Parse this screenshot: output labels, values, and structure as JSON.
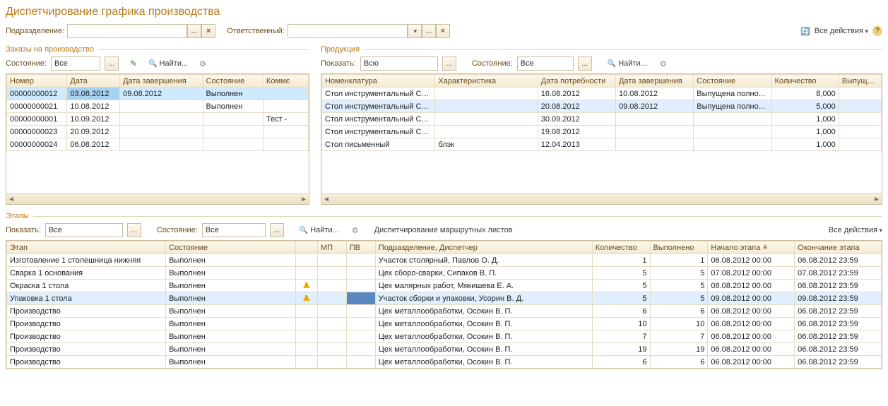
{
  "title": "Диспетчирование графика производства",
  "filters": {
    "dept_label": "Подразделение:",
    "dept_value": "",
    "resp_label": "Ответственный:",
    "resp_value": "",
    "all_actions": "Все действия"
  },
  "orders_section": {
    "legend": "Заказы на производство",
    "state_label": "Состояние:",
    "state_value": "Все",
    "find": "Найти...",
    "cols": {
      "num": "Номер",
      "date": "Дата",
      "end": "Дата завершения",
      "state": "Состояние",
      "comment": "Коммє"
    },
    "rows": [
      {
        "num": "00000000012",
        "date": "03.08.2012",
        "end": "09.08.2012",
        "state": "Выполнен",
        "comment": "",
        "sel": true
      },
      {
        "num": "00000000021",
        "date": "10.08.2012",
        "end": "",
        "state": "Выполнен",
        "comment": ""
      },
      {
        "num": "00000000001",
        "date": "10.09.2012",
        "end": "",
        "state": "",
        "comment": "Тест -"
      },
      {
        "num": "00000000023",
        "date": "20.09.2012",
        "end": "",
        "state": "",
        "comment": ""
      },
      {
        "num": "00000000024",
        "date": "06.08.2012",
        "end": "",
        "state": "",
        "comment": ""
      }
    ]
  },
  "products_section": {
    "legend": "Продукция",
    "show_label": "Показать:",
    "show_value": "Всю",
    "state_label": "Состояние:",
    "state_value": "Все",
    "find": "Найти...",
    "cols": {
      "nom": "Номенклатура",
      "char": "Характеристика",
      "need": "Дата потребности",
      "end": "Дата завершения",
      "state": "Состояние",
      "qty": "Количество",
      "out": "Выпущено"
    },
    "rows": [
      {
        "nom": "Стол инструментальный СИ...",
        "char": "",
        "need": "16.08.2012",
        "end": "10.08.2012",
        "state": "Выпущена полно...",
        "qty": "8,000",
        "out": ""
      },
      {
        "nom": "Стол инструментальный СИ...",
        "char": "",
        "need": "20.08.2012",
        "end": "09.08.2012",
        "state": "Выпущена полно...",
        "qty": "5,000",
        "out": "",
        "sel": true
      },
      {
        "nom": "Стол инструментальный СИ...",
        "char": "",
        "need": "30.09.2012",
        "end": "",
        "state": "",
        "qty": "1,000",
        "out": ""
      },
      {
        "nom": "Стол инструментальный СИ...",
        "char": "",
        "need": "19.08.2012",
        "end": "",
        "state": "",
        "qty": "1,000",
        "out": ""
      },
      {
        "nom": "Стол письменный",
        "char": "блэк",
        "need": "12.04.2013",
        "end": "",
        "state": "",
        "qty": "1,000",
        "out": ""
      }
    ]
  },
  "stages_section": {
    "legend": "Этапы",
    "show_label": "Показать:",
    "show_value": "Все",
    "state_label": "Состояние:",
    "state_value": "Все",
    "find": "Найти...",
    "dispatch_link": "Диспетчирование маршрутных листов",
    "all_actions": "Все действия",
    "cols": {
      "stage": "Этап",
      "state": "Состояние",
      "warn": "",
      "mp": "МП",
      "pv": "ПВ",
      "dept": "Подразделение, Диспетчер",
      "qty": "Количество",
      "done": "Выполнено",
      "start": "Начало этапа",
      "end": "Окончание этапа"
    },
    "rows": [
      {
        "stage": "Изготовление 1 столешница нижняя",
        "state": "Выполнен",
        "warn": false,
        "dept": "Участок столярный, Павлов О. Д.",
        "qty": "1",
        "done": "1",
        "start": "06.08.2012 00:00",
        "end": "06.08.2012 23:59"
      },
      {
        "stage": "Сварка 1 основания",
        "state": "Выполнен",
        "warn": false,
        "dept": "Цех сборо-сварки, Сипаков В. П.",
        "qty": "5",
        "done": "5",
        "start": "07.08.2012 00:00",
        "end": "07.08.2012 23:59"
      },
      {
        "stage": "Окраска 1 стола",
        "state": "Выполнен",
        "warn": true,
        "dept": "Цех малярных работ, Мякишева Е. А.",
        "qty": "5",
        "done": "5",
        "start": "08.08.2012 00:00",
        "end": "08.08.2012 23:59"
      },
      {
        "stage": "Упаковка 1 стола",
        "state": "Выполнен",
        "warn": true,
        "dept": "Участок сборки и упаковки, Усорин В. Д.",
        "qty": "5",
        "done": "5",
        "start": "09.08.2012 00:00",
        "end": "09.08.2012 23:59",
        "sel": true
      },
      {
        "stage": "Производство",
        "state": "Выполнен",
        "warn": false,
        "dept": "Цех металлообработки, Осокин В. П.",
        "qty": "6",
        "done": "6",
        "start": "06.08.2012 00:00",
        "end": "06.08.2012 23:59"
      },
      {
        "stage": "Производство",
        "state": "Выполнен",
        "warn": false,
        "dept": "Цех металлообработки, Осокин В. П.",
        "qty": "10",
        "done": "10",
        "start": "06.08.2012 00:00",
        "end": "06.08.2012 23:59"
      },
      {
        "stage": "Производство",
        "state": "Выполнен",
        "warn": false,
        "dept": "Цех металлообработки, Осокин В. П.",
        "qty": "7",
        "done": "7",
        "start": "06.08.2012 00:00",
        "end": "06.08.2012 23:59"
      },
      {
        "stage": "Производство",
        "state": "Выполнен",
        "warn": false,
        "dept": "Цех металлообработки, Осокин В. П.",
        "qty": "19",
        "done": "19",
        "start": "06.08.2012 00:00",
        "end": "06.08.2012 23:59"
      },
      {
        "stage": "Производство",
        "state": "Выполнен",
        "warn": false,
        "dept": "Цех металлообработки, Осокин В. П.",
        "qty": "6",
        "done": "6",
        "start": "06.08.2012 00:00",
        "end": "06.08.2012 23:59"
      }
    ]
  }
}
